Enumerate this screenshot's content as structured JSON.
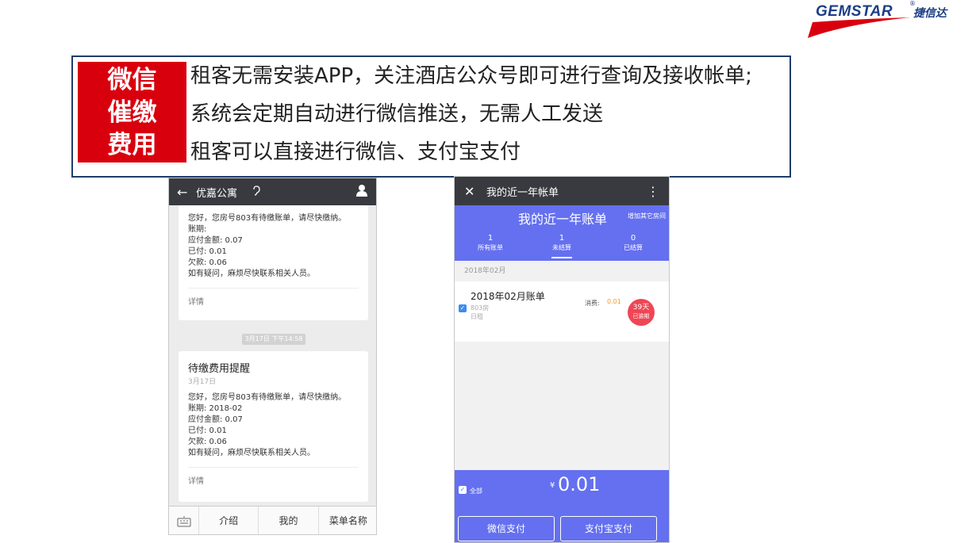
{
  "logo": {
    "brand": "GEMSTAR",
    "registered": "®",
    "brand_cn": "捷信达",
    "swoosh_color": "#d9000e",
    "text_color": "#1b3e86"
  },
  "badge": {
    "lines": [
      "微信",
      "催缴",
      "费用"
    ],
    "color": "#d9000e"
  },
  "features": [
    "租客无需安装APP，关注酒店公众号即可进行查询及接收帐单;",
    "系统会定期自动进行微信推送，无需人工发送",
    "租客可以直接进行微信、支付宝支付"
  ],
  "wechat_chat": {
    "title": "优嘉公寓",
    "card1": {
      "lines": [
        "您好，您房号803有待缴账单，请尽快缴纳。",
        "账期:",
        "应付金额: 0.07",
        "已付: 0.01",
        "欠款: 0.06",
        "如有疑问，麻烦尽快联系相关人员。"
      ],
      "detail": "详情"
    },
    "timestamp": "3月17日 下午14:58",
    "card2": {
      "title": "待缴费用提醒",
      "date": "3月17日",
      "lines": [
        "您好，您房号803有待缴账单，请尽快缴纳。",
        "账期: 2018-02",
        "应付金额: 0.07",
        "已付: 0.01",
        "欠款: 0.06",
        "如有疑问，麻烦尽快联系相关人员。"
      ],
      "detail": "详情"
    },
    "menu": [
      "介绍",
      "我的",
      "菜单名称"
    ]
  },
  "bill_page": {
    "nav_title": "我的近一年帐单",
    "header_title": "我的近一年账单",
    "add_room": "增加其它房间",
    "stats": [
      {
        "count": "1",
        "label": "所有账单"
      },
      {
        "count": "1",
        "label": "未结算"
      },
      {
        "count": "0",
        "label": "已结算"
      }
    ],
    "month": "2018年02月",
    "bill": {
      "title": "2018年02月账单",
      "room": "803房",
      "type": "日租",
      "fee_label": "消费:",
      "fee": "0.01",
      "due_days": "39天",
      "due_status": "已逾期"
    },
    "footer": {
      "select_all": "全部",
      "currency": "¥",
      "amount": "0.01",
      "wechat_pay": "微信支付",
      "alipay": "支付宝支付"
    },
    "accent_color": "#6470f0"
  }
}
